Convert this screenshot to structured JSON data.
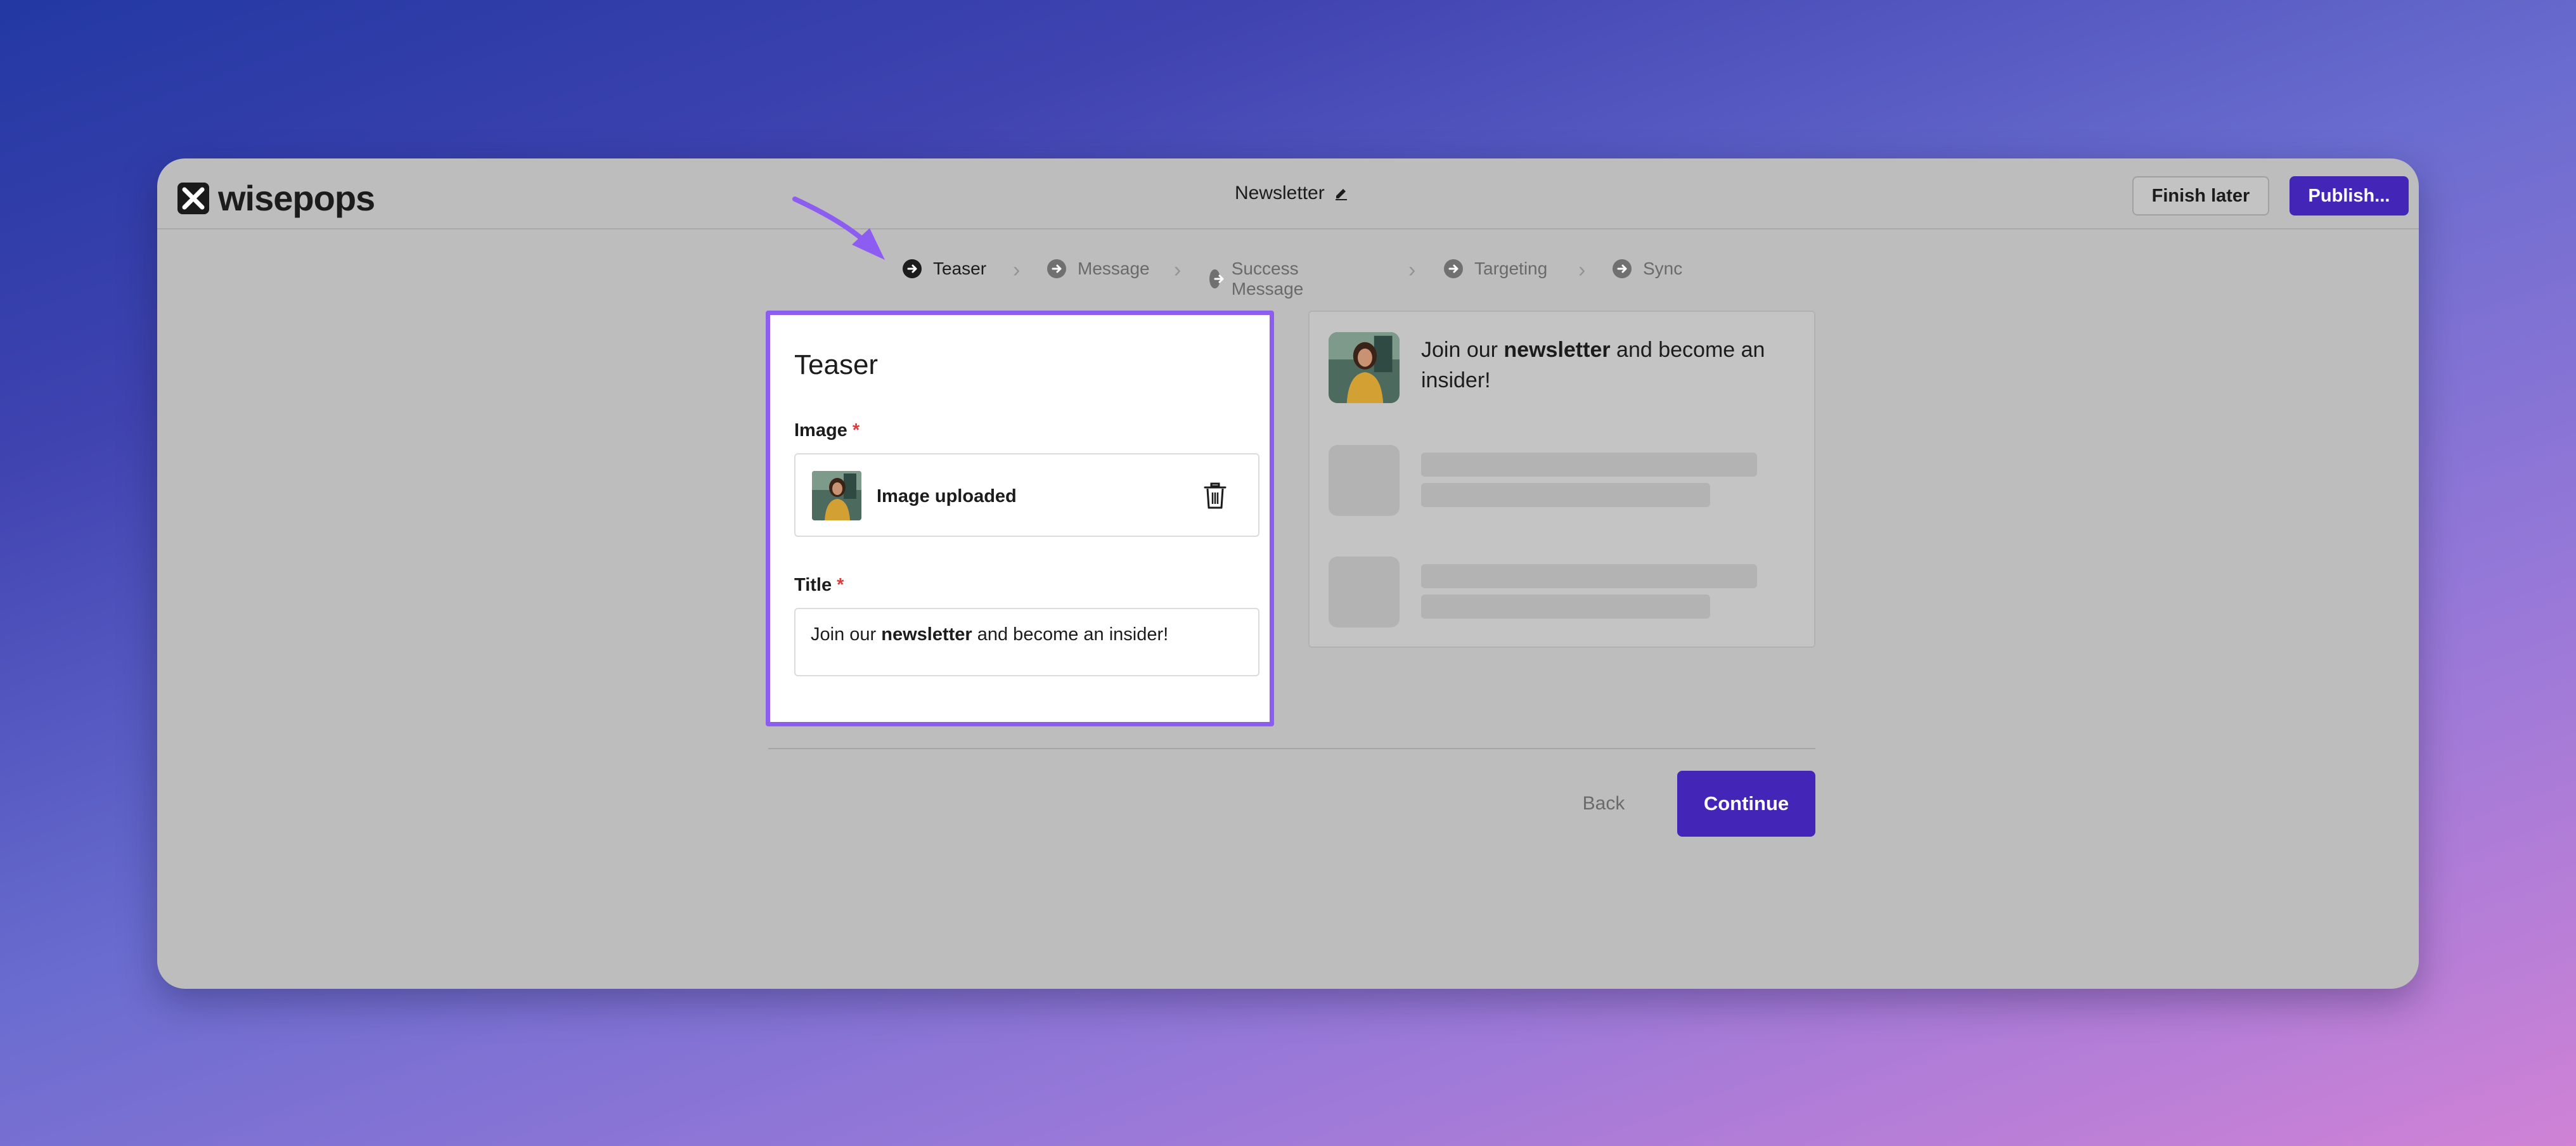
{
  "app": {
    "logo_text": "wisepops"
  },
  "header": {
    "title": "Newsletter",
    "finish_later_label": "Finish later",
    "publish_label": "Publish..."
  },
  "steps": [
    {
      "label": "Teaser",
      "active": true
    },
    {
      "label": "Message",
      "active": false
    },
    {
      "label": "Success Message",
      "active": false
    },
    {
      "label": "Targeting",
      "active": false
    },
    {
      "label": "Sync",
      "active": false
    }
  ],
  "form": {
    "heading": "Teaser",
    "image_label": "Image",
    "required_mark": "*",
    "upload_status": "Image uploaded",
    "title_label": "Title",
    "title_value": {
      "before": "Join our ",
      "bold": "newsletter",
      "after": " and become an insider!"
    }
  },
  "preview": {
    "before": "Join our ",
    "bold": "newsletter",
    "after": " and become an insider!"
  },
  "footer": {
    "back_label": "Back",
    "continue_label": "Continue"
  },
  "colors": {
    "accent": "#4326b8",
    "highlight_border": "#8d5cf0",
    "required": "#e03b3b"
  }
}
